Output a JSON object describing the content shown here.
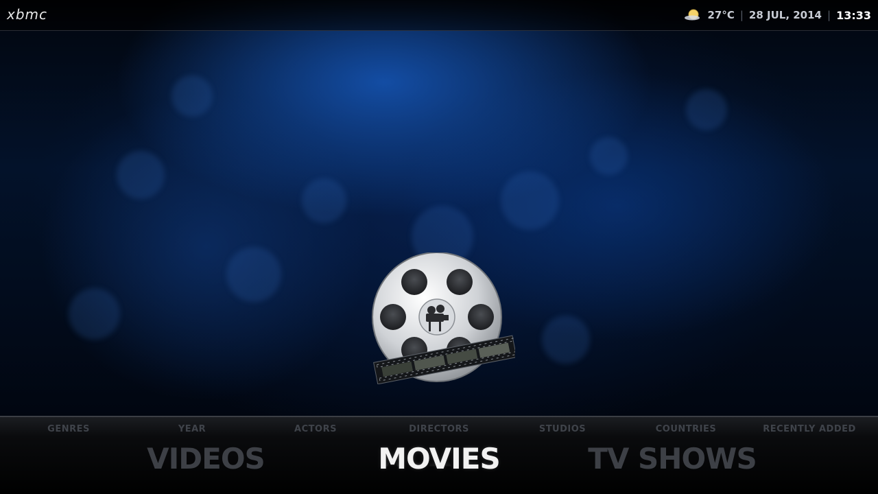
{
  "app": {
    "logo": "xbmc"
  },
  "status": {
    "weather_icon": "partly-sunny-icon",
    "temperature": "27°C",
    "date": "28 JUL, 2014",
    "time": "13:33",
    "separator": "|"
  },
  "center_icon": "movies-film-reel-icon",
  "submenu": {
    "items": [
      "GENRES",
      "YEAR",
      "ACTORS",
      "DIRECTORS",
      "STUDIOS",
      "COUNTRIES",
      "RECENTLY ADDED"
    ]
  },
  "mainmenu": {
    "items": [
      "VIDEOS",
      "MOVIES",
      "TV SHOWS"
    ],
    "selected": "MOVIES"
  },
  "colors": {
    "accent_blue": "#1450aa",
    "menu_inactive": "#3d4046",
    "menu_active": "#f2f2f2"
  }
}
